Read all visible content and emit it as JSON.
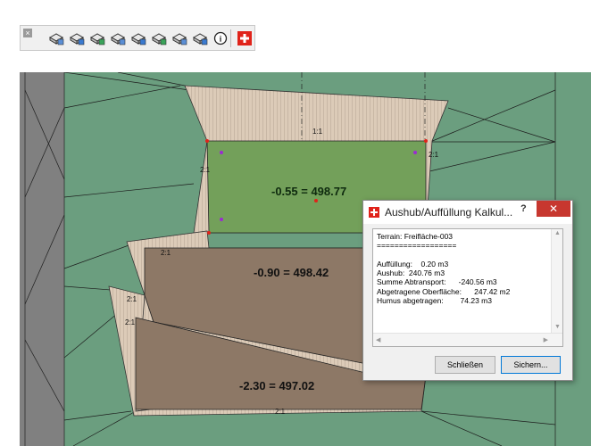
{
  "toolbar": {
    "close_symbol": "×",
    "tools": [
      {
        "name": "add-terrain-icon"
      },
      {
        "name": "terrain-plan-icon"
      },
      {
        "name": "terrain-list-icon"
      },
      {
        "name": "terrain-edit-icon"
      },
      {
        "name": "terrain-refresh-icon"
      },
      {
        "name": "terrain-table-icon"
      },
      {
        "name": "terrain-copy-icon"
      },
      {
        "name": "terrain-export-icon"
      }
    ],
    "info_symbol": "i",
    "brand_color": "#e0231a"
  },
  "plan": {
    "colors": {
      "terrain": "#6b9e7f",
      "slope": "#dccbb8",
      "platform_green": "#73a05a",
      "platform_brown": "#8d7866",
      "road": "#808080"
    },
    "platforms": [
      {
        "label": "-0.55 = 498.77"
      },
      {
        "label": "-0.90 = 498.42"
      },
      {
        "label": "-2.30 = 497.02"
      }
    ],
    "slope_labels": [
      "1:1",
      "2:1",
      "2:1",
      "2:1",
      "2:1",
      "2:1",
      "2:1"
    ]
  },
  "dialog": {
    "title": "Aushub/Auffüllung Kalkul...",
    "help_symbol": "?",
    "close_symbol": "✕",
    "lines": [
      "Terrain: Freifläche-003",
      "==================",
      "",
      "Auffüllung:    0.20 m3",
      "Aushub:  240.76 m3",
      "Summe Abtransport:      -240.56 m3",
      "Abgetragene Oberfläche:      247.42 m2",
      "Humus abgetragen:        74.23 m3"
    ],
    "buttons": {
      "close": "Schließen",
      "save": "Sichern..."
    }
  }
}
